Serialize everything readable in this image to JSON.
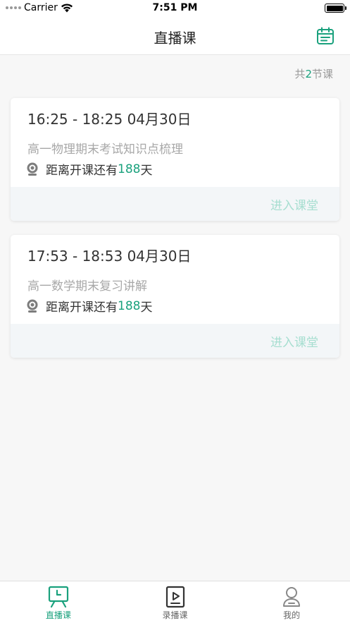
{
  "status_bar": {
    "carrier": "Carrier",
    "time": "7:51 PM"
  },
  "nav": {
    "title": "直播课"
  },
  "summary": {
    "prefix": "共",
    "count": "2",
    "suffix": "节课"
  },
  "courses": [
    {
      "time": "16:25 - 18:25  04月30日",
      "title": "高一物理期末考试知识点梳理",
      "countdown_prefix": "距离开课还有",
      "days": "188",
      "countdown_suffix": "天",
      "enter_label": "进入课堂"
    },
    {
      "time": "17:53 - 18:53  04月30日",
      "title": "高一数学期末复习讲解",
      "countdown_prefix": "距离开课还有",
      "days": "188",
      "countdown_suffix": "天",
      "enter_label": "进入课堂"
    }
  ],
  "tabs": [
    {
      "label": "直播课",
      "icon": "live-class-icon",
      "active": true
    },
    {
      "label": "录播课",
      "icon": "recorded-class-icon",
      "active": false
    },
    {
      "label": "我的",
      "icon": "profile-icon",
      "active": false
    }
  ],
  "colors": {
    "accent": "#1aa17d",
    "accent_light": "#a6ded0",
    "muted_text": "#a8a8a8"
  }
}
